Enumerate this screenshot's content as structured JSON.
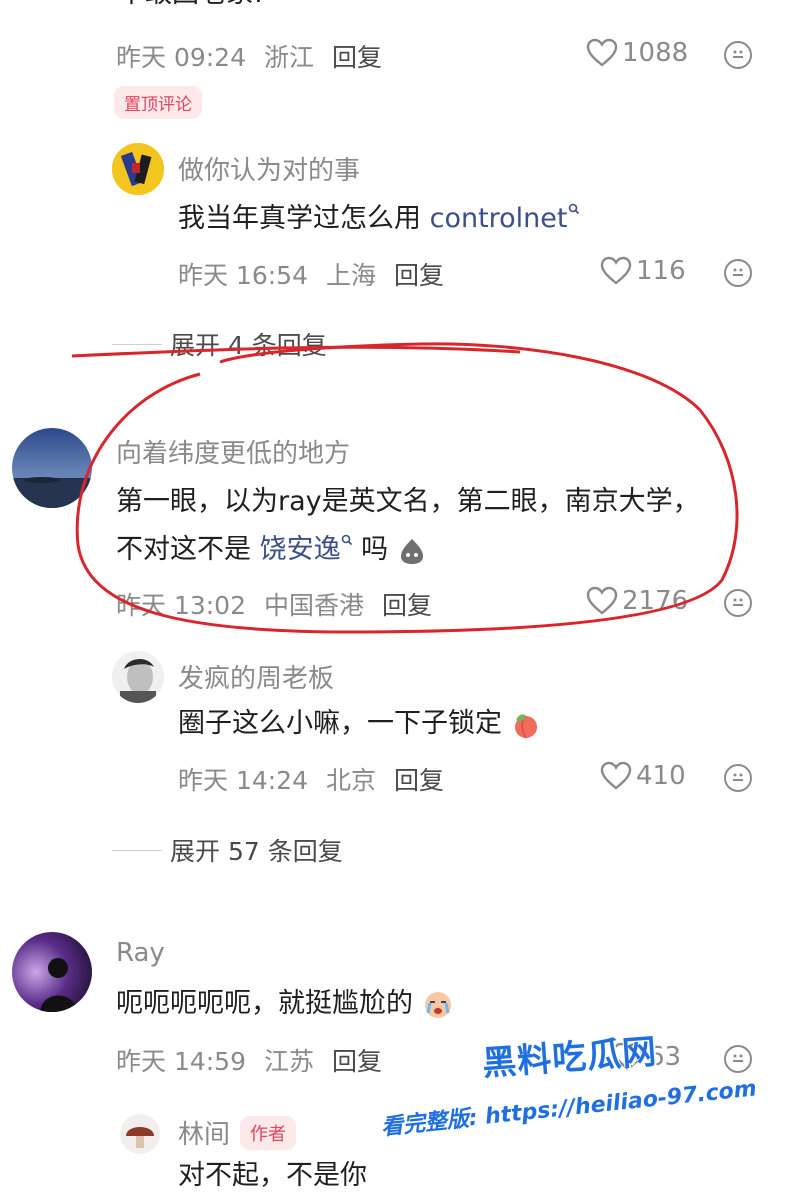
{
  "comment0": {
    "text_tail": "不敢回老家!",
    "time": "昨天 09:24",
    "location": "浙江",
    "reply_label": "回复",
    "likes": "1088",
    "pinned_label": "置顶评论"
  },
  "reply0": {
    "user": "做你认为对的事",
    "text_prefix": "我当年真学过怎么用 ",
    "link": "controlnet",
    "time": "昨天 16:54",
    "location": "上海",
    "reply_label": "回复",
    "likes": "116",
    "expand_label": "展开 4 条回复"
  },
  "comment1": {
    "user": "向着纬度更低的地方",
    "line1": "第一眼，以为ray是英文名，第二眼，南京大学，",
    "line2_prefix": "不对这不是 ",
    "link": "饶安逸",
    "line2_suffix": " 吗",
    "time": "昨天 13:02",
    "location": "中国香港",
    "reply_label": "回复",
    "likes": "2176"
  },
  "reply1": {
    "user": "发疯的周老板",
    "text": "圈子这么小嘛，一下子锁定",
    "time": "昨天 14:24",
    "location": "北京",
    "reply_label": "回复",
    "likes": "410",
    "expand_label": "展开 57 条回复"
  },
  "comment2": {
    "user": "Ray",
    "text": "呃呃呃呃呃，就挺尴尬的",
    "time": "昨天 14:59",
    "location": "江苏",
    "reply_label": "回复",
    "likes": "63"
  },
  "reply2": {
    "user": "林间",
    "author_badge": "作者",
    "text": "对不起，不是你"
  },
  "watermark": {
    "title": "黑料吃瓜网",
    "line": "看完整版: https://heiliao-97.com"
  },
  "colors": {
    "annotation_red": "#d9262c",
    "link_blue": "#3b4f8a",
    "badge_pink": "#e5435b"
  }
}
